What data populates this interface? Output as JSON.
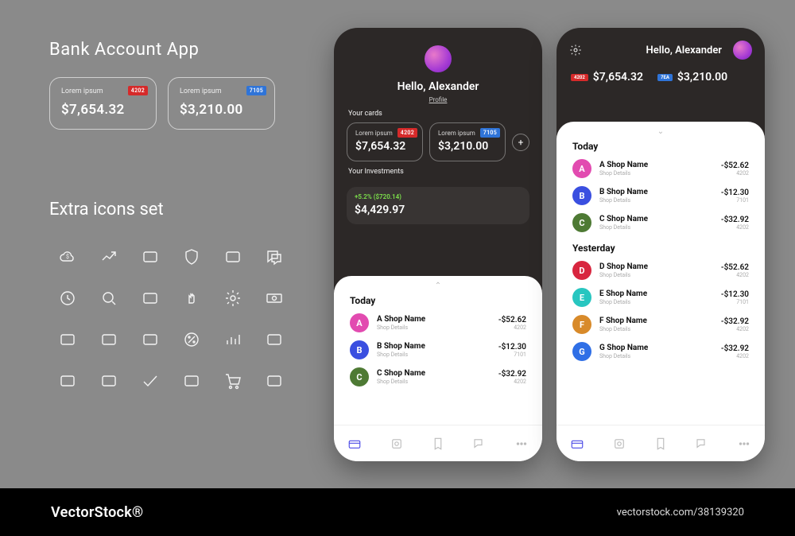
{
  "title": "Bank Account App",
  "left_cards": [
    {
      "label": "Lorem ipsum",
      "amount": "$7,654.32",
      "chip": "4202",
      "chipClass": "red"
    },
    {
      "label": "Lorem ipsum",
      "amount": "$3,210.00",
      "chip": "7105",
      "chipClass": "blue"
    }
  ],
  "icons_title": "Extra icons set",
  "icons": [
    "cloud-dollar-icon",
    "trend-up-icon",
    "cards-icon",
    "shield-icon",
    "exchange-icon",
    "chat-icon",
    "clock-icon",
    "search-icon",
    "devices-icon",
    "pointer-icon",
    "gear-icon",
    "cash-icon",
    "briefcase-icon",
    "calculator-icon",
    "delivery-icon",
    "percent-icon",
    "bars-icon",
    "wallet-icon",
    "presentation-icon",
    "news-icon",
    "check-icon",
    "coins-icon",
    "cart-icon",
    "document-icon"
  ],
  "phone1": {
    "greeting": "Hello, Alexander",
    "profile": "Profile",
    "cards_label": "Your cards",
    "cards": [
      {
        "label": "Lorem ipsum",
        "amount": "$7,654.32",
        "chip": "4202",
        "chipClass": "red"
      },
      {
        "label": "Lorem ipsum",
        "amount": "$3,210.00",
        "chip": "7105",
        "chipClass": "blue"
      }
    ],
    "inv_label": "Your Investments",
    "inv_growth": "+5.2% ($720.14)",
    "inv_amount": "$4,429.97",
    "today_label": "Today",
    "tx": [
      {
        "letter": "A",
        "cls": "cA",
        "name": "A Shop Name",
        "sub": "Shop Details",
        "amount": "-$52.62",
        "code": "4202"
      },
      {
        "letter": "B",
        "cls": "cB",
        "name": "B Shop Name",
        "sub": "Shop Details",
        "amount": "-$12.30",
        "code": "7101"
      },
      {
        "letter": "C",
        "cls": "cC",
        "name": "C Shop Name",
        "sub": "Shop Details",
        "amount": "-$32.92",
        "code": "4202"
      }
    ]
  },
  "phone2": {
    "greeting": "Hello, Alexander",
    "balances": [
      {
        "chip": "4202",
        "chipClass": "red",
        "amount": "$7,654.32"
      },
      {
        "chip": "7EA",
        "chipClass": "blue",
        "amount": "$3,210.00"
      }
    ],
    "today_label": "Today",
    "today": [
      {
        "letter": "A",
        "cls": "cA",
        "name": "A Shop Name",
        "sub": "Shop Details",
        "amount": "-$52.62",
        "code": "4202"
      },
      {
        "letter": "B",
        "cls": "cB",
        "name": "B Shop Name",
        "sub": "Shop Details",
        "amount": "-$12.30",
        "code": "7101"
      },
      {
        "letter": "C",
        "cls": "cC",
        "name": "C Shop Name",
        "sub": "Shop Details",
        "amount": "-$32.92",
        "code": "4202"
      }
    ],
    "yesterday_label": "Yesterday",
    "yesterday": [
      {
        "letter": "D",
        "cls": "cD",
        "name": "D Shop Name",
        "sub": "Shop Details",
        "amount": "-$52.62",
        "code": "4202"
      },
      {
        "letter": "E",
        "cls": "cE",
        "name": "E Shop Name",
        "sub": "Shop Details",
        "amount": "-$12.30",
        "code": "7101"
      },
      {
        "letter": "F",
        "cls": "cF",
        "name": "F Shop Name",
        "sub": "Shop Details",
        "amount": "-$32.92",
        "code": "4202"
      },
      {
        "letter": "G",
        "cls": "cG",
        "name": "G Shop Name",
        "sub": "Shop Details",
        "amount": "-$32.92",
        "code": "4202"
      }
    ]
  },
  "nav": [
    "card-icon",
    "safe-icon",
    "receipt-icon",
    "chat-icon",
    "more-icon"
  ],
  "footer": {
    "brand": "VectorStock®",
    "url": "vectorstock.com/38139320"
  }
}
